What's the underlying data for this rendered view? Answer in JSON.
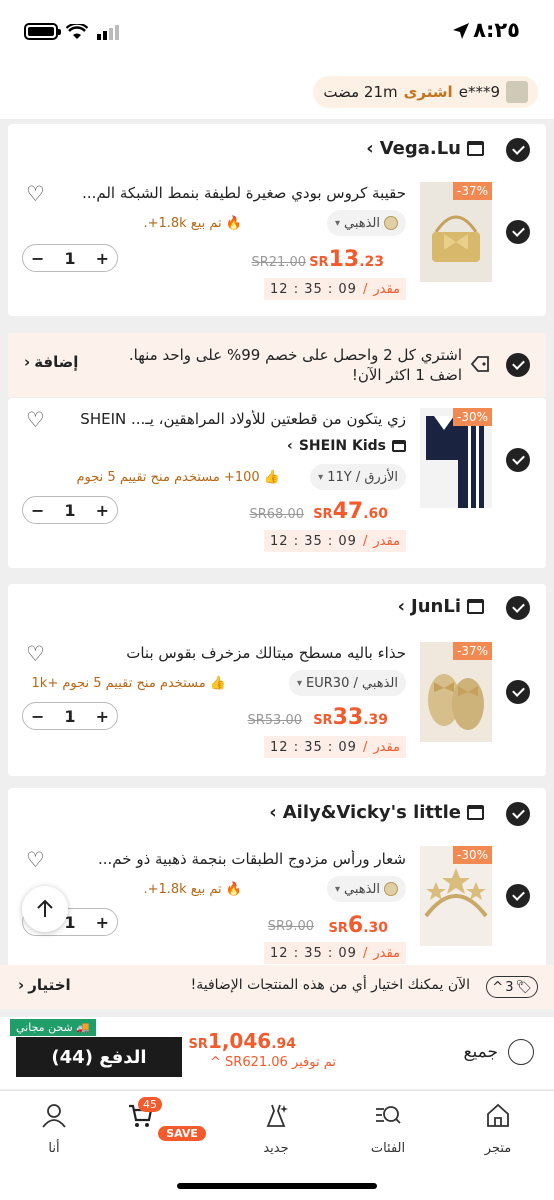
{
  "status": {
    "time": "٨:٢٥"
  },
  "ticker": {
    "user": "e***9",
    "action": "اشترى",
    "ago": "21m مضت"
  },
  "items": [
    {
      "store": "Vega.Lu",
      "title": "حقيبة كروس بودي صغيرة لطيفة بنمط الشبكة الم...",
      "variant": "الذهبي",
      "sold": "تم بيع 1.8k+.",
      "currency": "SR",
      "price_int": "13",
      "price_dec": ".23",
      "old": "SR21.00",
      "discount": "-37%",
      "qty": "1",
      "timer_label": "مقدر",
      "timer": "12 : 35 : 09"
    },
    {
      "store": "SHEIN Kids",
      "title": "زي يتكون من قطعتين للأولاد المراهقين، يـ... SHEIN",
      "variant": "الأزرق / 11Y",
      "sold": "100+ مستخدم منح تقييم 5 نجوم",
      "currency": "SR",
      "price_int": "47",
      "price_dec": ".60",
      "old": "SR68.00",
      "discount": "-30%",
      "qty": "1",
      "timer_label": "مقدر",
      "timer": "12 : 35 : 09"
    },
    {
      "store": "JunLi",
      "title": "حذاء باليه مسطح ميتالك مزخرف بقوس بنات",
      "variant": "الذهبي / EUR30",
      "sold": "مستخدم منح تقييم 5 نجوم +1k",
      "currency": "SR",
      "price_int": "33",
      "price_dec": ".39",
      "old": "SR53.00",
      "discount": "-37%",
      "qty": "1",
      "timer_label": "مقدر",
      "timer": "12 : 35 : 09"
    },
    {
      "store": "Aily&Vicky's little",
      "title": "شعار ورأس مزدوج الطبقات بنجمة ذهبية ذو خم...",
      "variant": "الذهبي",
      "sold": "تم بيع 1.8k+.",
      "currency": "SR",
      "price_int": "6",
      "price_dec": ".30",
      "old": "SR9.00",
      "discount": "-30%",
      "qty": "1",
      "timer_label": "مقدر",
      "timer": "12 : 35 : 09"
    }
  ],
  "promo": {
    "line1": "اشتري كل 2 واحصل على خصم 99% على واحد منها.",
    "line2": "اضف 1 اكثر الآن!",
    "add": "إضافة"
  },
  "addon": {
    "count": "3",
    "text": "الآن يمكنك اختيار أي من هذه المنتجات الإضافية!",
    "choose": "اختيار"
  },
  "checkout": {
    "all": "جميع",
    "currency": "SR",
    "total_int": "1,046",
    "total_dec": ".94",
    "saving": "تم توفير SR621.06",
    "pay": "الدفع (44)",
    "free_ship": "شحن مجاني"
  },
  "nav": {
    "store": "متجر",
    "categories": "الفئات",
    "new": "جديد",
    "cart_badge": "45",
    "cart_save": "SAVE",
    "me": "أنا"
  }
}
